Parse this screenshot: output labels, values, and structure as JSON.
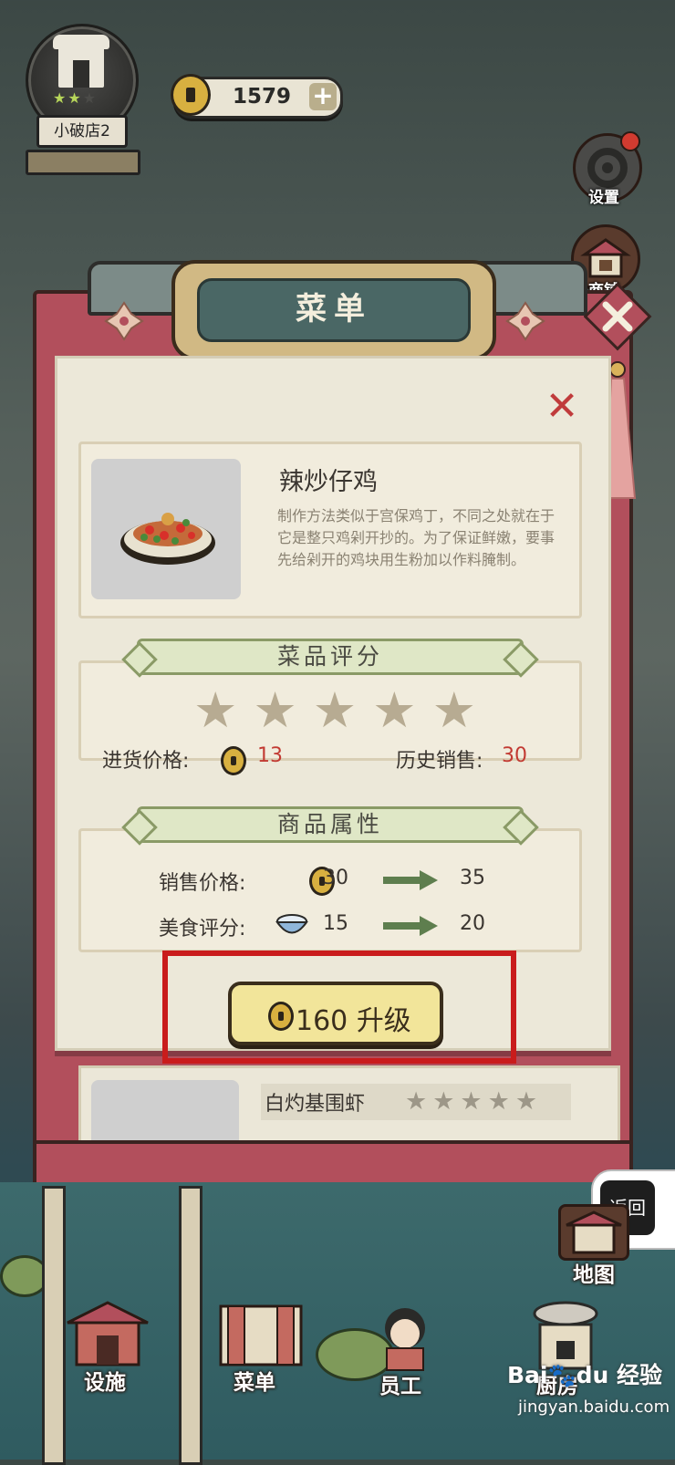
{
  "hud": {
    "shop_name": "小破店2",
    "shop_stars": 2,
    "shop_stars_max": 3,
    "coins": "1579",
    "plus_label": "+"
  },
  "side_buttons": {
    "settings": "设置",
    "shop": "商铺",
    "map": "地图",
    "back": "返回"
  },
  "panel": {
    "title": "菜单",
    "dish": {
      "name": "辣炒仔鸡",
      "description": "制作方法类似于宫保鸡丁，不同之处就在于它是整只鸡剁开抄的。为了保证鲜嫩，要事先给剁开的鸡块用生粉加以作料腌制。"
    },
    "rating_section": {
      "title": "菜品评分",
      "stars": 5,
      "stars_max": 5,
      "cost_label": "进货价格:",
      "cost_value": "13",
      "sales_label": "历史销售:",
      "sales_value": "30"
    },
    "attributes_section": {
      "title": "商品属性",
      "price_label": "销售价格:",
      "price_current": "30",
      "price_next": "35",
      "food_label": "美食评分:",
      "food_current": "15",
      "food_next": "20"
    },
    "upgrade": {
      "cost": "160",
      "label": "升级"
    },
    "next_dish": {
      "name": "白灼基围虾",
      "stars": "★★★★★"
    }
  },
  "bottom_nav": {
    "facilities": "设施",
    "menu": "菜单",
    "staff": "员工",
    "kitchen": "厨房"
  },
  "watermark": {
    "brand": "Bai🐾du 经验",
    "url": "jingyan.baidu.com"
  },
  "colors": {
    "board": "#b24f5c",
    "paper": "#ece8d9",
    "highlight": "#c91c1c",
    "arrow": "#5e7e4e",
    "accent_red": "#c23a32"
  }
}
